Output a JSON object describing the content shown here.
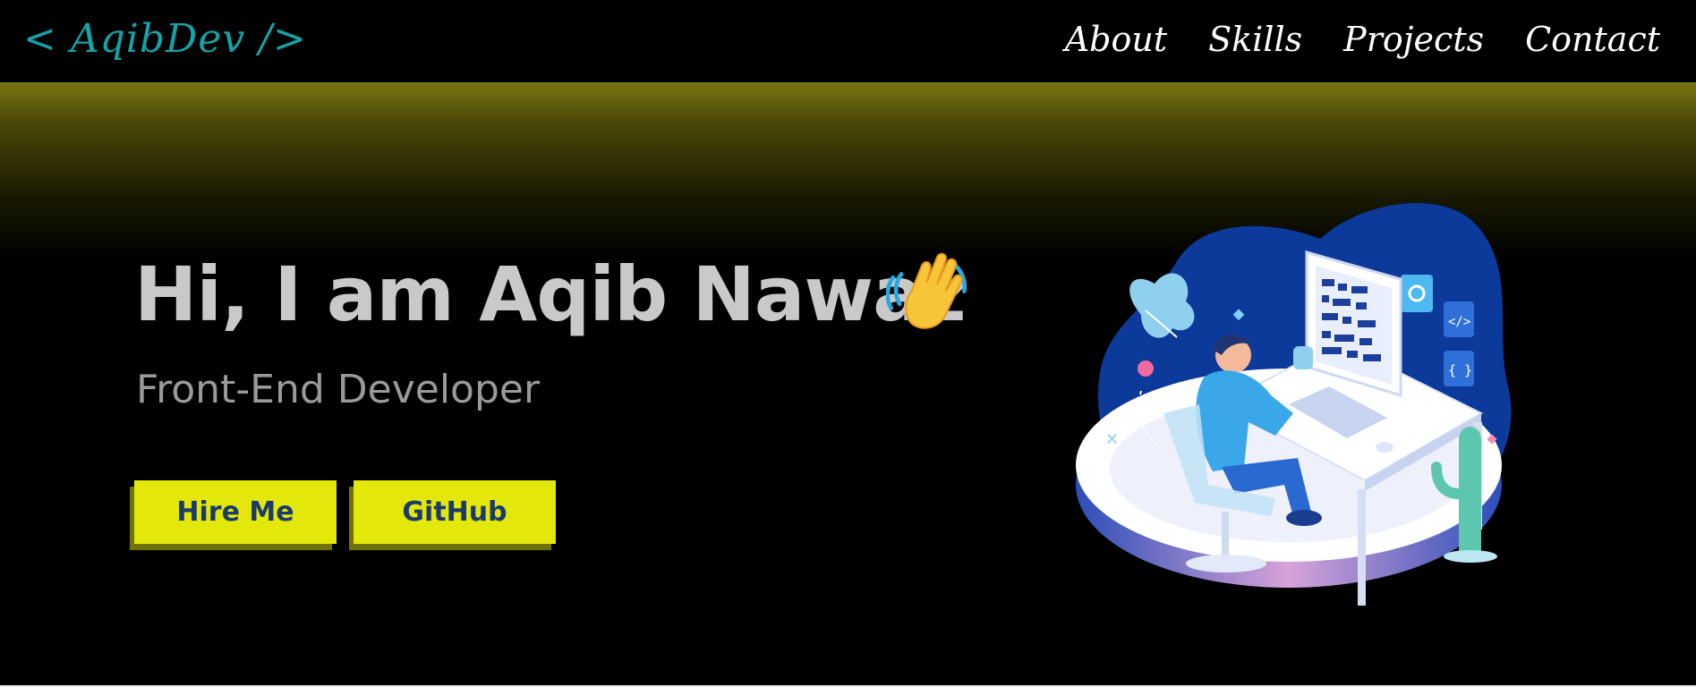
{
  "navbar": {
    "logo": "< AqibDev />",
    "links": [
      "About",
      "Skills",
      "Projects",
      "Contact"
    ]
  },
  "hero": {
    "title": "Hi, I am Aqib Nawaz",
    "subtitle": "Front-End Developer",
    "buttons": {
      "hire": "Hire Me",
      "github": "GitHub"
    },
    "icons": {
      "wave": "waving-hand-icon",
      "illustration": "developer-at-desk-illustration"
    }
  },
  "colors": {
    "logo": "#14a3a8",
    "button_bg": "#e3e80a",
    "button_text": "#1c3a6b",
    "gradient_top": "#797610",
    "title": "#c9c9c9",
    "subtitle": "#9a9a9a",
    "blob": "#0b3a9b"
  }
}
